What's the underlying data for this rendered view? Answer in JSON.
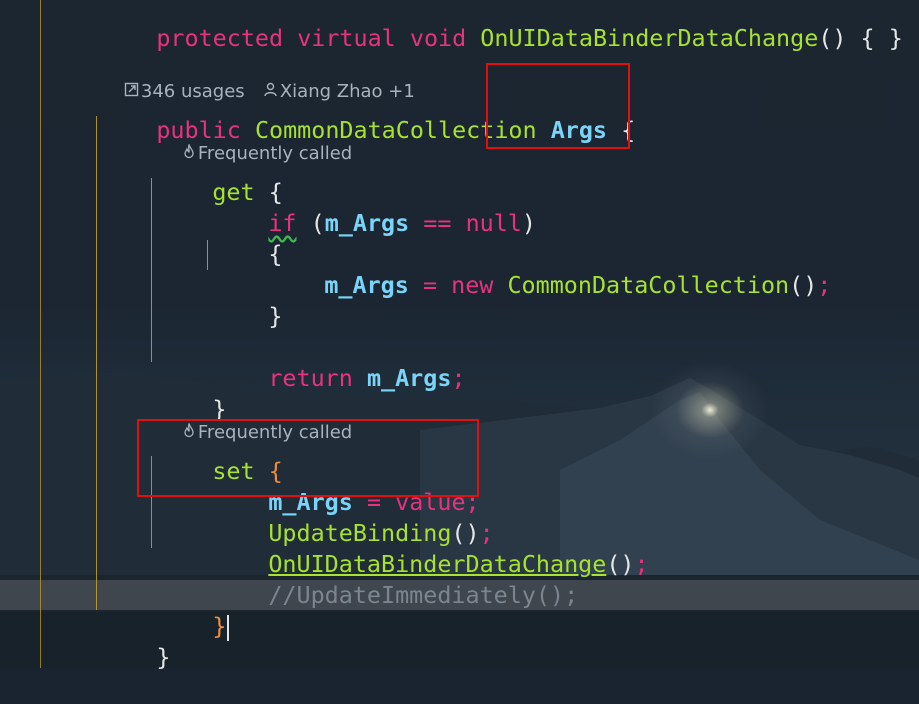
{
  "code": {
    "line0": {
      "kw1": "protected",
      "kw2": "virtual",
      "kw3": "void",
      "method": "OnUIDataBinderDataChange",
      "rest": "() { }"
    },
    "codelens": {
      "usages": "346 usages",
      "author": "Xiang Zhao +1"
    },
    "decl": {
      "kw": "public",
      "type": "CommonDataCollection",
      "name": "Args",
      "brace": "{"
    },
    "hint_get": "Frequently called",
    "get": {
      "kw": "get",
      "brace": "{"
    },
    "if_line": {
      "kw": "if",
      "open": "(",
      "field": "m_Args",
      "op": "==",
      "null": "null",
      "close": ")"
    },
    "open_brace": "{",
    "assign_new": {
      "field": "m_Args",
      "op": "=",
      "kw": "new",
      "type": "CommonDataCollection",
      "call": "()",
      "semi": ";"
    },
    "close_brace": "}",
    "return_line": {
      "kw": "return",
      "field": "m_Args",
      "semi": ";"
    },
    "get_close": "}",
    "hint_set": "Frequently called",
    "set": {
      "kw": "set",
      "brace": "{"
    },
    "set_assign": {
      "field": "m_Args",
      "op": "=",
      "value": "value",
      "semi": ";"
    },
    "update_binding": {
      "method": "UpdateBinding",
      "call": "()",
      "semi": ";"
    },
    "on_change": {
      "method": "OnUIDataBinderDataChange",
      "call": "()",
      "semi": ";"
    },
    "comment": "//UpdateImmediately();",
    "set_close": "}",
    "class_close": "}"
  },
  "icons": {
    "usages": "external-link-icon",
    "author": "person-icon",
    "hint": "flame-icon"
  },
  "colors": {
    "keyword": "#e8327e",
    "type": "#a6e22e",
    "identifier": "#79d4f7",
    "annotation_box": "#e01010",
    "indent_guide": "#c9a227"
  }
}
